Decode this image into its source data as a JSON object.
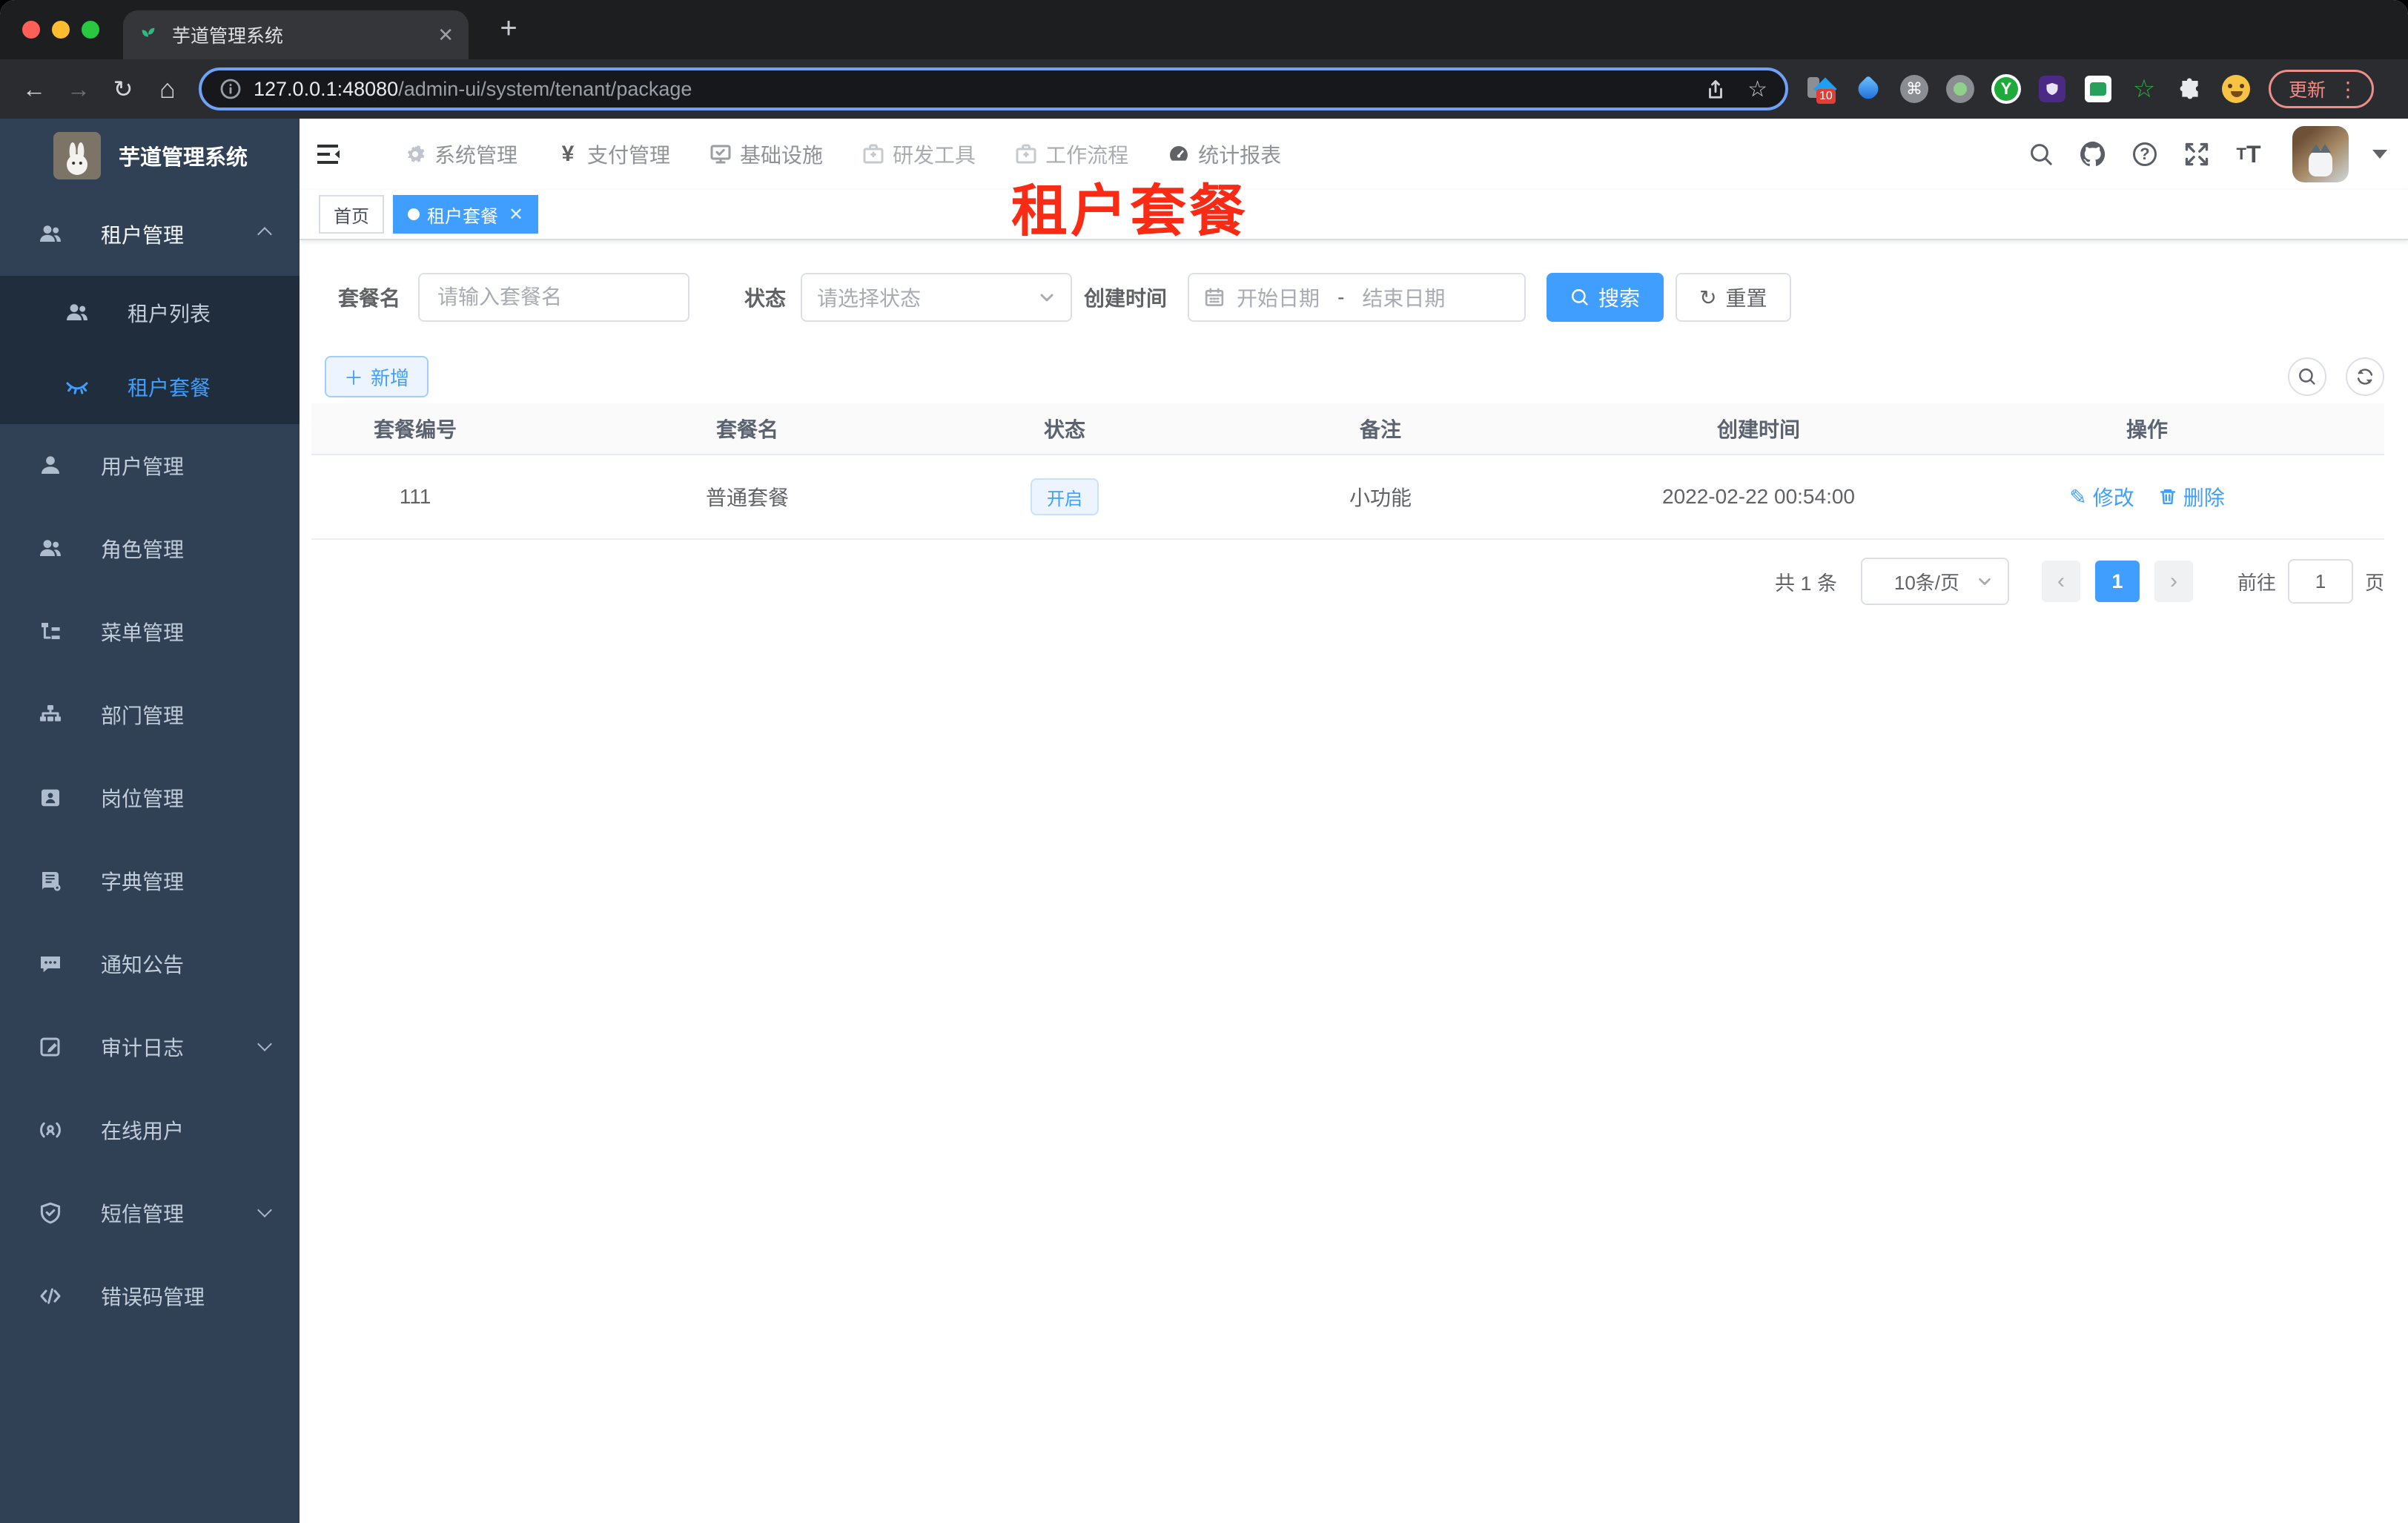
{
  "browser": {
    "tab_title": "芋道管理系统",
    "url_host": "127.0.0.1:48080",
    "url_path": "/admin-ui/system/tenant/package",
    "extension_badge": "10",
    "update_label": "更新"
  },
  "app": {
    "title": "芋道管理系统"
  },
  "topnav": {
    "items": [
      {
        "label": "系统管理"
      },
      {
        "label": "支付管理"
      },
      {
        "label": "基础设施"
      },
      {
        "label": "研发工具"
      },
      {
        "label": "工作流程"
      },
      {
        "label": "统计报表"
      }
    ]
  },
  "sidebar": {
    "items": [
      {
        "label": "租户管理"
      },
      {
        "label": "租户列表"
      },
      {
        "label": "租户套餐"
      },
      {
        "label": "用户管理"
      },
      {
        "label": "角色管理"
      },
      {
        "label": "菜单管理"
      },
      {
        "label": "部门管理"
      },
      {
        "label": "岗位管理"
      },
      {
        "label": "字典管理"
      },
      {
        "label": "通知公告"
      },
      {
        "label": "审计日志"
      },
      {
        "label": "在线用户"
      },
      {
        "label": "短信管理"
      },
      {
        "label": "错误码管理"
      }
    ]
  },
  "tags": {
    "home": "首页",
    "active": "租户套餐"
  },
  "annotation": {
    "text": "租户套餐"
  },
  "filters": {
    "name_label": "套餐名",
    "name_placeholder": "请输入套餐名",
    "status_label": "状态",
    "status_placeholder": "请选择状态",
    "date_label": "创建时间",
    "date_start": "开始日期",
    "date_sep": "-",
    "date_end": "结束日期",
    "search": "搜索",
    "reset": "重置",
    "add": "新增"
  },
  "table": {
    "headers": [
      "套餐编号",
      "套餐名",
      "状态",
      "备注",
      "创建时间",
      "操作"
    ],
    "row": {
      "id": "111",
      "name": "普通套餐",
      "status": "开启",
      "remark": "小功能",
      "created": "2022-02-22 00:54:00",
      "edit": "修改",
      "delete": "删除"
    }
  },
  "pagination": {
    "total": "共 1 条",
    "page_size": "10条/页",
    "page": "1",
    "goto": "前往",
    "jump_value": "1",
    "unit": "页"
  }
}
